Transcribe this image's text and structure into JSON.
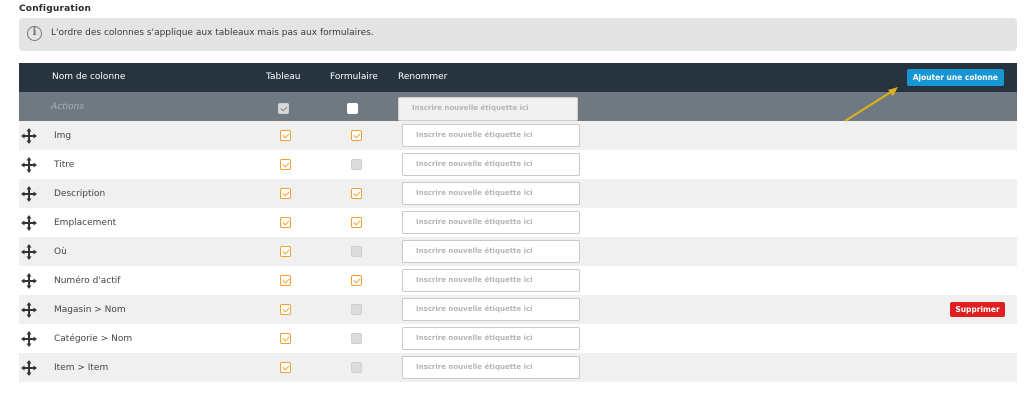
{
  "section_title": "Configuration",
  "info": {
    "text": "L'ordre des colonnes s'applique aux tableaux mais pas aux formulaires.",
    "icon": "info-icon"
  },
  "headers": {
    "name": "Nom de colonne",
    "tableau": "Tableau",
    "formulaire": "Formulaire",
    "renommer": "Renommer"
  },
  "add_button": "Ajouter une colonne",
  "placeholder": "Inscrire nouvelle étiquette ici",
  "delete_button": "Supprimer",
  "colors": {
    "header_bg": "#27333f",
    "add_button": "#1796d4",
    "delete_button": "#e02020",
    "check": "#f0a030",
    "arrow": "#e0b21a"
  },
  "actions_row": {
    "label": "Actions",
    "tableau": true,
    "formulaire": false
  },
  "rows": [
    {
      "label": "Img",
      "tableau": true,
      "formulaire": true,
      "formulaire_enabled": true
    },
    {
      "label": "Titre",
      "tableau": true,
      "formulaire": false,
      "formulaire_enabled": false
    },
    {
      "label": "Description",
      "tableau": true,
      "formulaire": true,
      "formulaire_enabled": true
    },
    {
      "label": "Emplacement",
      "tableau": true,
      "formulaire": true,
      "formulaire_enabled": true
    },
    {
      "label": "Où",
      "tableau": true,
      "formulaire": false,
      "formulaire_enabled": false
    },
    {
      "label": "Numéro d'actif",
      "tableau": true,
      "formulaire": true,
      "formulaire_enabled": true
    },
    {
      "label": "Magasin > Nom",
      "tableau": true,
      "formulaire": false,
      "formulaire_enabled": false,
      "deletable": true
    },
    {
      "label": "Catégorie > Nom",
      "tableau": true,
      "formulaire": false,
      "formulaire_enabled": false
    },
    {
      "label": "Item > Item",
      "tableau": true,
      "formulaire": false,
      "formulaire_enabled": false
    }
  ]
}
